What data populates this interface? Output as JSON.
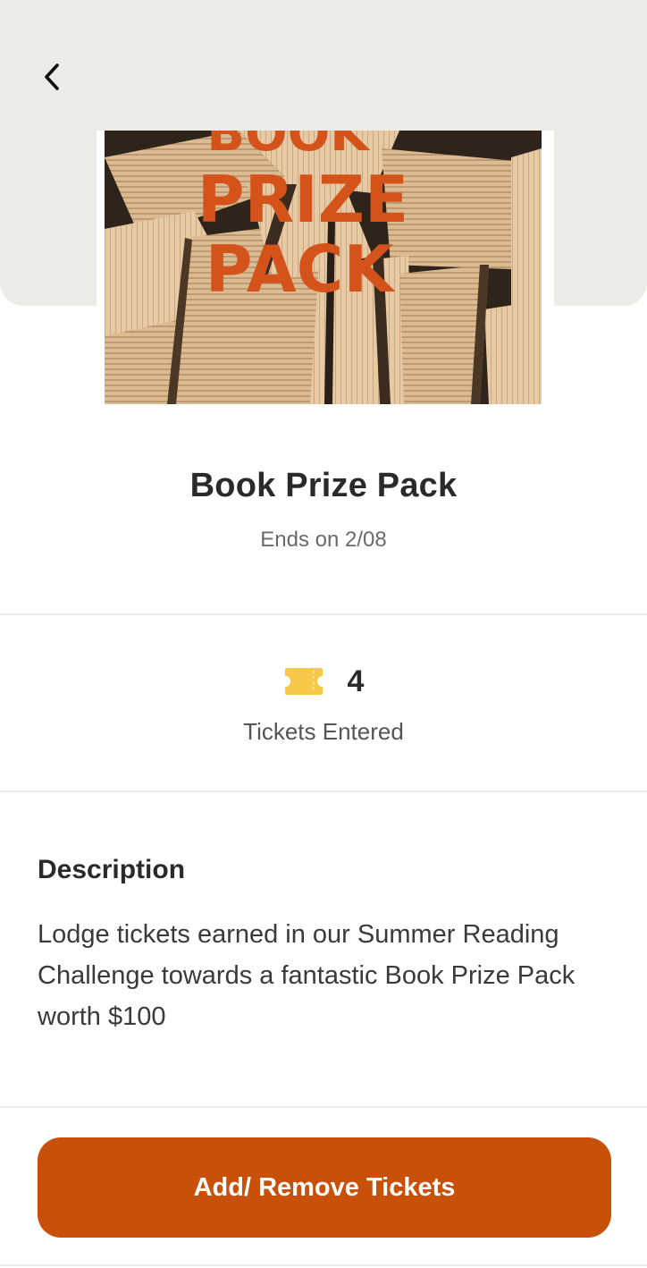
{
  "header": {
    "back_icon": "chevron-left-icon"
  },
  "hero": {
    "overlay_line1": "BOOK",
    "overlay_line2": "PRIZE",
    "overlay_line3": "PACK",
    "overlay_color": "#d3531a"
  },
  "prize": {
    "title": "Book Prize Pack",
    "ends": "Ends on 2/08"
  },
  "tickets": {
    "icon": "ticket-icon",
    "count": "4",
    "label": "Tickets Entered"
  },
  "description": {
    "heading": "Description",
    "text": "Lodge tickets earned in our Summer Reading Challenge towards a fantastic Book Prize Pack worth $100"
  },
  "cta": {
    "label": "Add/ Remove Tickets"
  },
  "colors": {
    "header_bg": "#ebece8",
    "accent": "#c85008",
    "ticket": "#f7c948"
  }
}
